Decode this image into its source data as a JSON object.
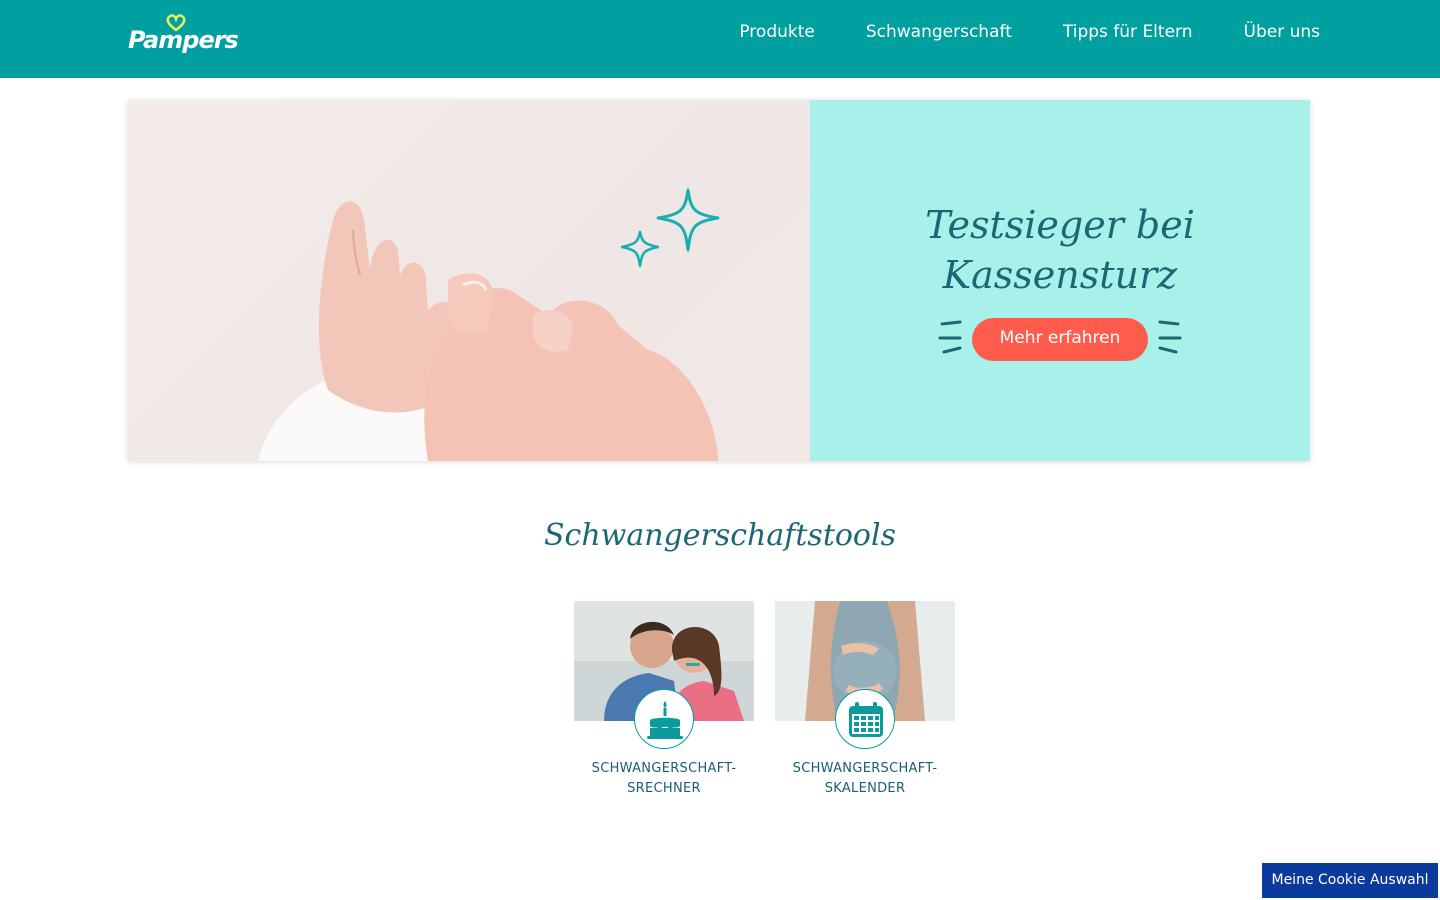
{
  "header": {
    "logo_text": "Pampers",
    "nav": [
      "Produkte",
      "Schwangerschaft",
      "Tipps für Eltern",
      "Über uns"
    ]
  },
  "hero": {
    "title_line1": "Testsieger bei",
    "title_line2": "Kassensturz",
    "button_label": "Mehr erfahren"
  },
  "tools": {
    "heading": "Schwangerschaftstools",
    "items": [
      {
        "label_line1": "SCHWANGERSCHAFT-",
        "label_line2": "SRECHNER",
        "icon": "cake-icon"
      },
      {
        "label_line1": "SCHWANGERSCHAFT-",
        "label_line2": "SKALENDER",
        "icon": "calendar-icon"
      }
    ]
  },
  "cookie": {
    "label": "Meine Cookie Auswahl"
  },
  "colors": {
    "header_bg": "#01a0a0",
    "hero_panel_bg": "#a8f1ea",
    "button_bg": "#ff5c4d",
    "cookie_bg": "#0a3a9c",
    "title_color": "#1b6874"
  }
}
